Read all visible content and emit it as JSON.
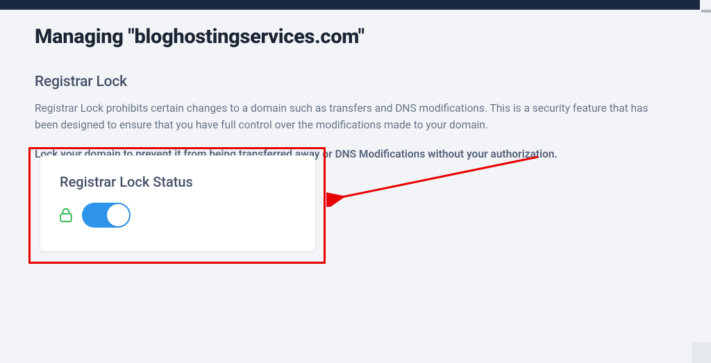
{
  "page": {
    "title": "Managing \"bloghostingservices.com\""
  },
  "section": {
    "title": "Registrar Lock",
    "description": "Registrar Lock prohibits certain changes to a domain such as transfers and DNS modifications. This is a security feature that has been designed to ensure that you have full control over the modifications made to your domain.",
    "instruction": "Lock your domain to prevent it from being transferred away or DNS Modifications without your authorization."
  },
  "card": {
    "title": "Registrar Lock Status",
    "locked": true
  },
  "colors": {
    "toggle_on": "#2e93ea",
    "lock_icon": "#27b548",
    "highlight": "#e80000"
  }
}
